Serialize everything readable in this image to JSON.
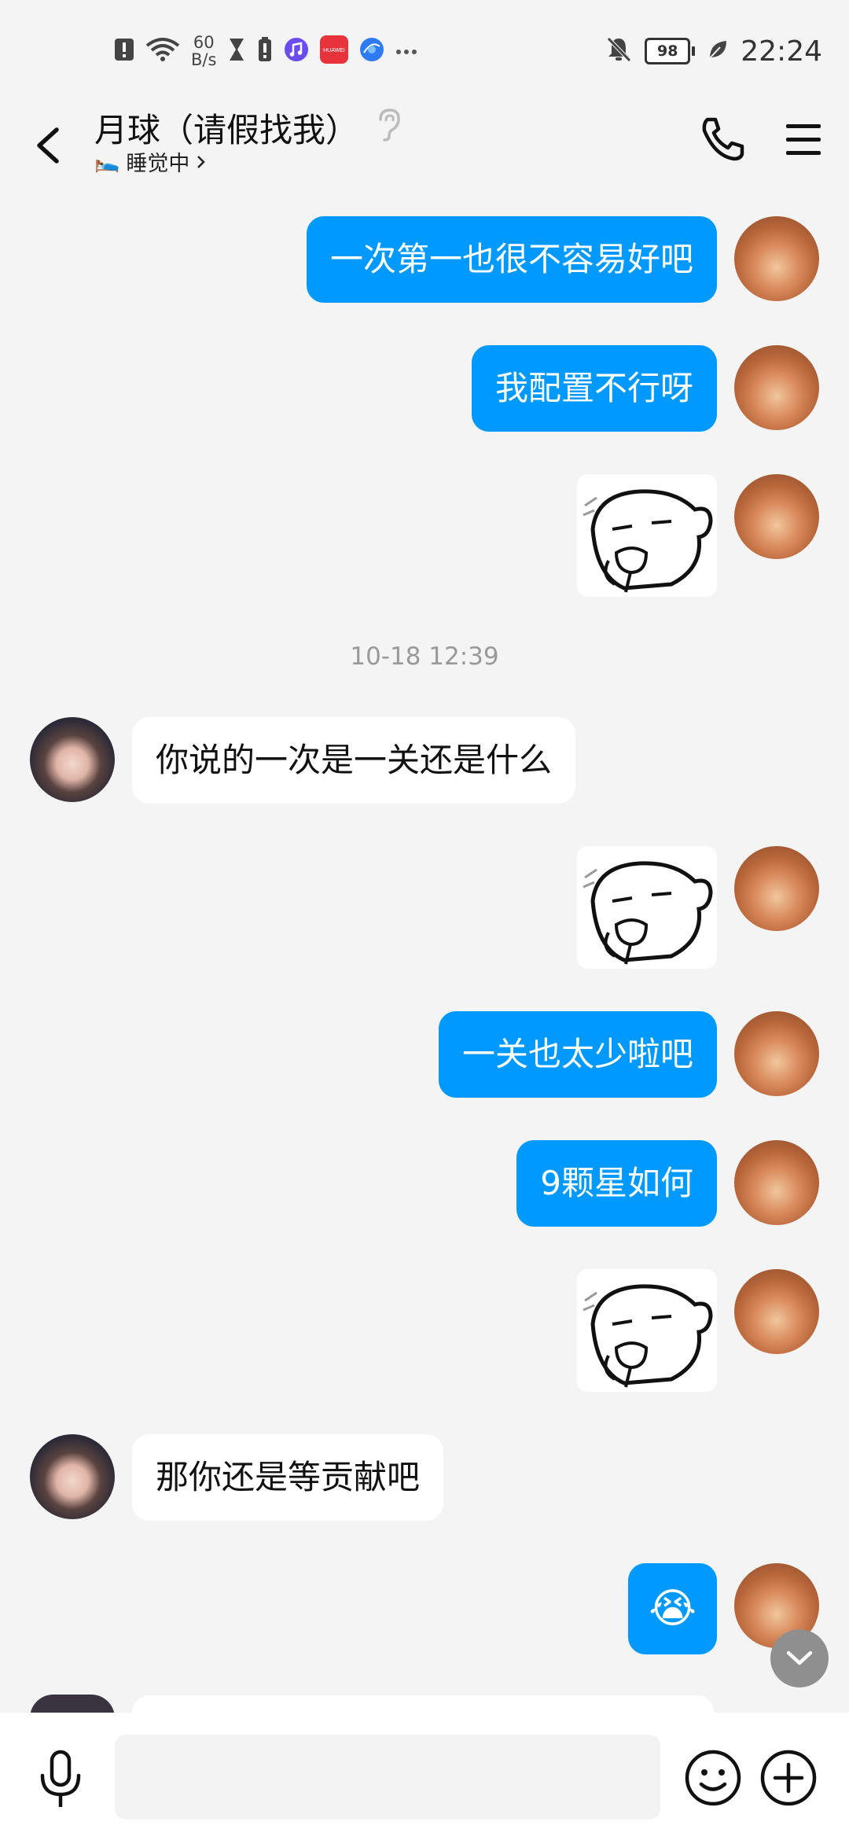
{
  "status_bar": {
    "net_speed_value": "60",
    "net_speed_unit": "B/s",
    "battery": "98",
    "time": "22:24",
    "huawei_label": "HUAWEI"
  },
  "header": {
    "title": "月球（请假找我）",
    "status": "睡觉中",
    "status_emoji": "🛌"
  },
  "messages": {
    "m1": "一次第一也很不容易好吧",
    "m2": "我配置不行呀",
    "timestamp": "10-18 12:39",
    "m3": "你说的一次是一关还是什么",
    "m4": "一关也太少啦吧",
    "m5": "9颗星如何",
    "m6": "那你还是等贡献吧",
    "m7_emoji": "😭"
  },
  "input": {
    "placeholder": ""
  },
  "colors": {
    "bubble_out": "#0099ff",
    "bubble_in": "#ffffff",
    "background": "#f4f4f4"
  }
}
